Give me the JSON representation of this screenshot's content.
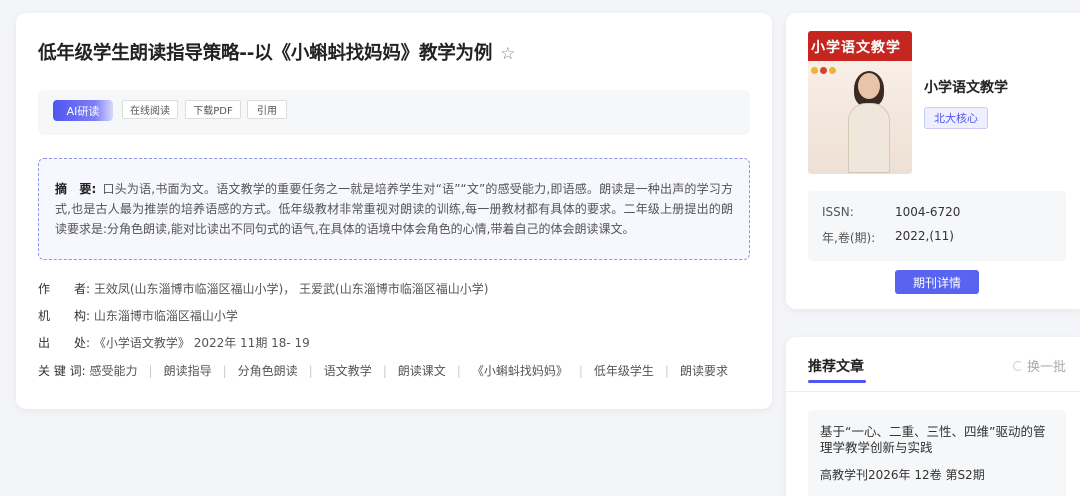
{
  "article": {
    "title": "低年级学生朗读指导策略--以《小蝌蚪找妈妈》教学为例",
    "star_icon": "☆"
  },
  "toolbar": {
    "ai_label": "AI研读",
    "read_online": "在线阅读",
    "download_pdf": "下载PDF",
    "cite": "引用"
  },
  "abstract": {
    "label": "摘　要:",
    "text": "口头为语,书面为文。语文教学的重要任务之一就是培养学生对“语”“文”的感受能力,即语感。朗读是一种出声的学习方式,也是古人最为推崇的培养语感的方式。低年级教材非常重视对朗读的训练,每一册教材都有具体的要求。二年级上册提出的朗读要求是:分角色朗读,能对比读出不同句式的语气,在具体的语境中体会角色的心情,带着自己的体会朗读课文。"
  },
  "meta": {
    "authors_label": "作　　者:",
    "authors": "王效凤(山东淄博市临淄区福山小学)， 王爱武(山东淄博市临淄区福山小学)",
    "org_label": "机　　构:",
    "org": "山东淄博市临淄区福山小学",
    "source_label": "出　　处:",
    "source": "《小学语文教学》 2022年 11期 18- 19",
    "keywords_label": "关 键 词:",
    "keywords": [
      "感受能力",
      "朗读指导",
      "分角色朗读",
      "语文教学",
      "朗读课文",
      "《小蝌蚪找妈妈》",
      "低年级学生",
      "朗读要求"
    ]
  },
  "journal": {
    "cover_title": "小学语文教学",
    "name": "小学语文教学",
    "badge": "北大核心",
    "issn_label": "ISSN:",
    "issn": "1004-6720",
    "volume_label": "年,卷(期):",
    "volume": "2022,(11)",
    "detail_button": "期刊详情"
  },
  "recommended": {
    "title": "推荐文章",
    "refresh": "换一批",
    "items": [
      {
        "title": "基于“一心、二重、三性、四维”驱动的管理学教学创新与实践",
        "source": "高教学刊2026年 12卷 第S2期"
      }
    ]
  }
}
